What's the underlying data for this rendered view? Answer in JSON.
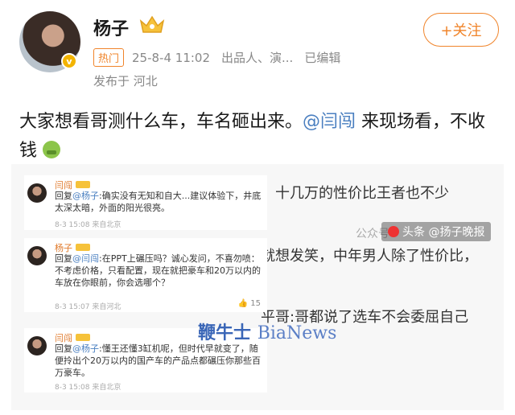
{
  "header": {
    "name": "杨子",
    "follow_label": "+关注",
    "hot_tag": "热门",
    "datetime": "25-8-4 11:02",
    "source": "出品人、演...",
    "edited": "已编辑",
    "location": "发布于 河北",
    "avatar_badge": "v"
  },
  "post": {
    "text_before": "大家想看哥测什么车，车名砸出来。",
    "mention": "@闫闯",
    "text_after": " 来现场看，不收钱"
  },
  "comments": [
    {
      "name": "闫闯",
      "reply_prefix": "回复",
      "reply_target": "@杨子",
      "text": ":确实没有无知和自大...建议体验下，井底太深太暗，外面的阳光很亮。",
      "meta": "8-3 15:08 来自北京"
    },
    {
      "name": "杨子",
      "reply_prefix": "回复",
      "reply_target": "@闫闯",
      "text": ":在PPT上碾压吗？诚心发问，不喜勿喷：不考虑价格，只看配置，现在就把豪车和20万以内的车放在你眼前，你会选哪个？",
      "meta": "8-3 15:07 来自河北",
      "likes": "15"
    },
    {
      "name": "闫闯",
      "reply_prefix": "回复",
      "reply_target": "@杨子",
      "text": ":懂王还懂3缸机呢，但时代早就变了，随便拎出个20万以内的国产车的产品点都碾压你那些百万豪车。",
      "meta": "8-3 15:08 来自北京"
    }
  ],
  "side_texts": [
    "，十几万的性价比王者也不少",
    "就想发笑，中年男人除了性价比，",
    "平哥:哥都说了选车不会委屈自己"
  ],
  "watermark": {
    "cn": "鞭牛士",
    "latin": "BiaNews"
  },
  "footer": {
    "public": "公众号",
    "badge": "头条 @扬子晚报"
  },
  "colors": {
    "accent": "#f0842a",
    "link": "#4a7fc0",
    "watermark": "#3a66b7"
  }
}
